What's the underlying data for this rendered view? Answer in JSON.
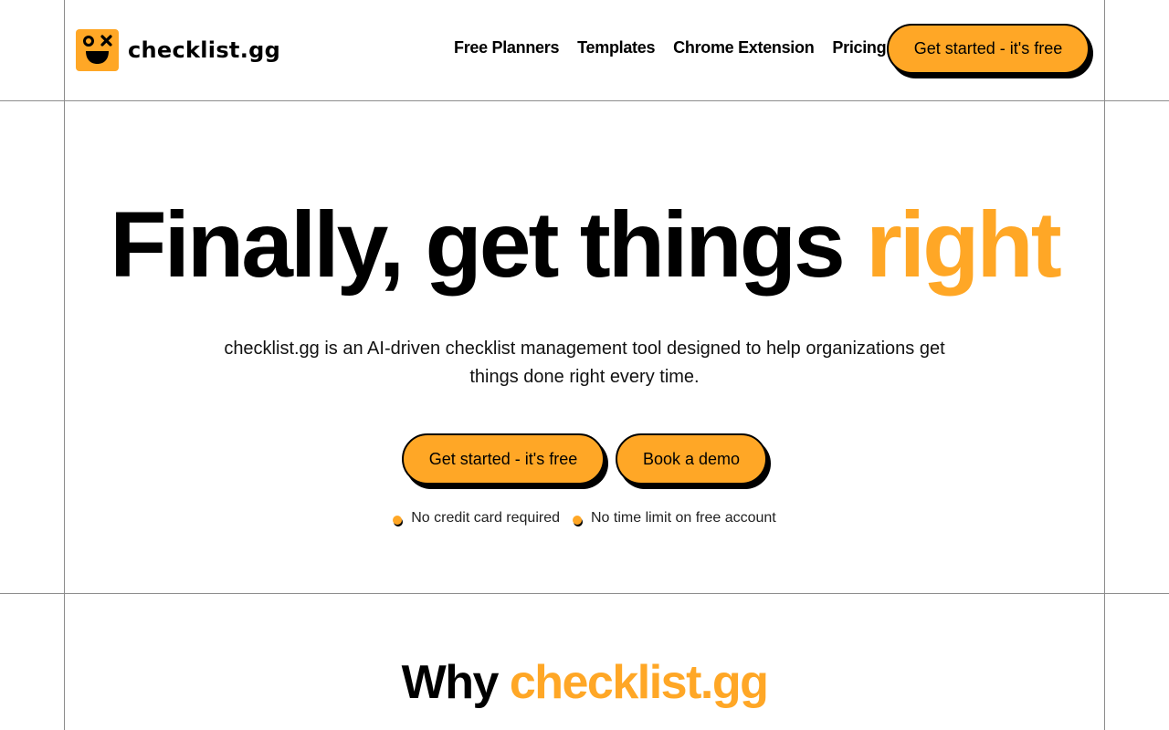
{
  "header": {
    "brand_name": "checklist.gg",
    "nav": [
      "Free Planners",
      "Templates",
      "Chrome Extension",
      "Pricing"
    ],
    "cta_label": "Get started - it's free"
  },
  "hero": {
    "title_main": "Finally, get things ",
    "title_accent": "right",
    "description": "checklist.gg is an AI-driven checklist management tool designed to help organizations get things done right every time.",
    "primary_button": "Get started - it's free",
    "secondary_button": "Book a demo",
    "perks": [
      "No credit card required",
      "No time limit on free account"
    ]
  },
  "why": {
    "title_main": "Why ",
    "title_accent": "checklist.gg"
  },
  "colors": {
    "accent": "#ffa726",
    "border": "#000000",
    "grid_lines": "#8c8c8c"
  }
}
